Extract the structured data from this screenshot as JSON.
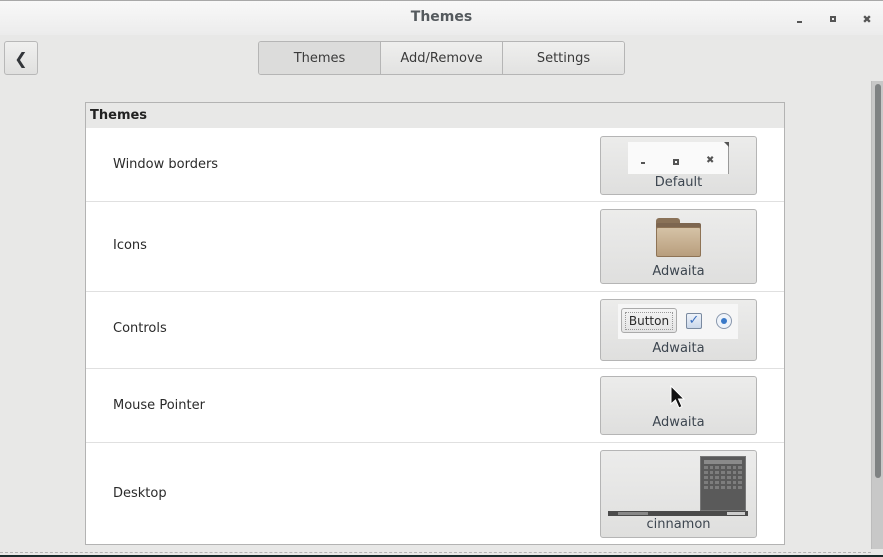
{
  "window": {
    "title": "Themes",
    "controls": {
      "minimize": "minimize",
      "maximize": "maximize",
      "close": "close"
    }
  },
  "toolbar": {
    "back_icon": "chevron-left-icon",
    "tabs": [
      {
        "label": "Themes",
        "active": true
      },
      {
        "label": "Add/Remove",
        "active": false
      },
      {
        "label": "Settings",
        "active": false
      }
    ]
  },
  "panel": {
    "header": "Themes",
    "rows": [
      {
        "label": "Window borders",
        "value": "Default",
        "preview": "window-buttons-preview"
      },
      {
        "label": "Icons",
        "value": "Adwaita",
        "preview": "folder-icon"
      },
      {
        "label": "Controls",
        "value": "Adwaita",
        "preview": "controls-preview",
        "preview_button_text": "Button"
      },
      {
        "label": "Mouse Pointer",
        "value": "Adwaita",
        "preview": "cursor-icon"
      },
      {
        "label": "Desktop",
        "value": "cinnamon",
        "preview": "desktop-preview"
      }
    ]
  },
  "colors": {
    "background": "#e8e8e7",
    "panel_bg": "#ffffff",
    "title_text": "#555a5e",
    "scroll_thumb": "#7f8283"
  }
}
